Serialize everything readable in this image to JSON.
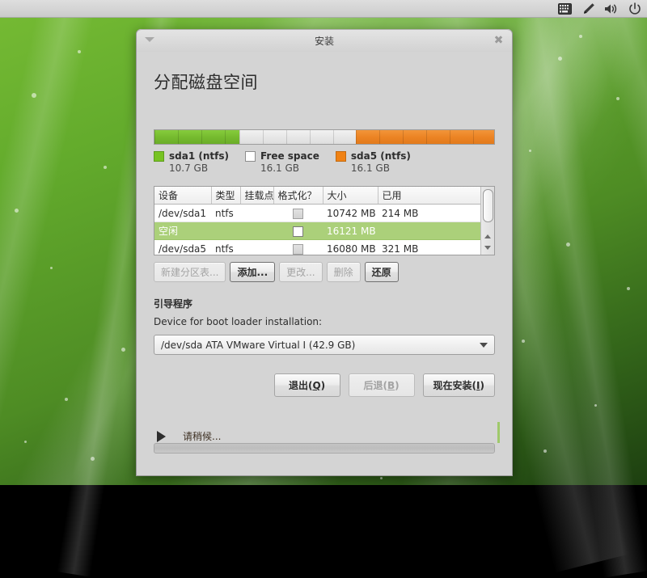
{
  "top_panel": {
    "tray_icons": [
      {
        "name": "keyboard-indicator-icon",
        "label": "keyboard-icon"
      },
      {
        "name": "accessibility-pen-icon",
        "label": "pen-icon"
      },
      {
        "name": "volume-icon",
        "label": "speaker-icon"
      },
      {
        "name": "power-icon",
        "label": "power-icon"
      }
    ]
  },
  "window": {
    "title": "安装",
    "close_label": "✖",
    "menu_label": "▾"
  },
  "page": {
    "heading": "分配磁盘空间"
  },
  "partition_bar": {
    "segments": [
      {
        "name": "sda1",
        "color": "#77c322",
        "percent": 25.0
      },
      {
        "name": "free",
        "color": "#ffffff",
        "percent": 34.2
      },
      {
        "name": "sda5",
        "color": "#f08214",
        "percent": 40.8
      }
    ]
  },
  "legend": [
    {
      "label": "sda1 (ntfs)",
      "size": "10.7 GB",
      "color": "#77c322",
      "swatch": "green"
    },
    {
      "label": "Free space",
      "size": "16.1 GB",
      "color": "#ffffff",
      "swatch": "white"
    },
    {
      "label": "sda5 (ntfs)",
      "size": "16.1 GB",
      "color": "#f08214",
      "swatch": "orange"
    }
  ],
  "table": {
    "columns": [
      "设备",
      "类型",
      "挂载点",
      "格式化？",
      "大小",
      "已用"
    ],
    "rows": [
      {
        "device": "/dev/sda1",
        "type": "ntfs",
        "mount": "",
        "format": false,
        "format_state": "unchecked-gray",
        "size": "10742 MB",
        "used": "214 MB",
        "selected": false
      },
      {
        "device": "空闲",
        "type": "",
        "mount": "",
        "format": false,
        "format_state": "unchecked-white",
        "size": "16121 MB",
        "used": "",
        "selected": true
      },
      {
        "device": "/dev/sda5",
        "type": "ntfs",
        "mount": "",
        "format": false,
        "format_state": "unchecked-gray",
        "size": "16080 MB",
        "used": "321 MB",
        "selected": false
      }
    ],
    "selection_color": "#abd07a"
  },
  "partition_buttons": [
    {
      "label": "新建分区表...",
      "enabled": false,
      "emphasis": false
    },
    {
      "label": "添加...",
      "enabled": true,
      "emphasis": true
    },
    {
      "label": "更改...",
      "enabled": false,
      "emphasis": false
    },
    {
      "label": "删除",
      "enabled": false,
      "emphasis": false
    },
    {
      "label": "还原",
      "enabled": true,
      "emphasis": true
    }
  ],
  "boot_loader": {
    "heading": "引导程序",
    "sub_label": "Device for boot loader installation:",
    "selected_value": "/dev/sda ATA VMware Virtual I (42.9 GB)"
  },
  "nav_buttons": [
    {
      "name": "quit",
      "text_before": "退出(",
      "mnemonic": "Q",
      "text_after": ")",
      "enabled": true
    },
    {
      "name": "back",
      "text_before": "后退(",
      "mnemonic": "B",
      "text_after": ")",
      "enabled": false
    },
    {
      "name": "install-now",
      "text_before": "现在安装(",
      "mnemonic": "I",
      "text_after": ")",
      "enabled": true
    }
  ],
  "status": {
    "text": "请稍候...",
    "expander": "▶"
  },
  "progress": {
    "percent": 0
  }
}
